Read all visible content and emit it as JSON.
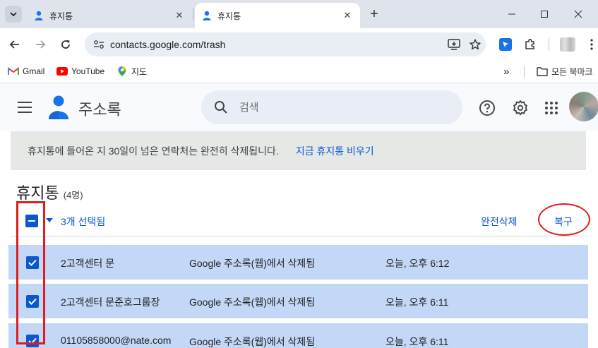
{
  "browser": {
    "tabs": [
      {
        "title": "휴지통",
        "active": false
      },
      {
        "title": "휴지통",
        "active": true
      }
    ],
    "url": "contacts.google.com/trash",
    "bookmarks": [
      {
        "label": "Gmail",
        "icon": "gmail-icon"
      },
      {
        "label": "YouTube",
        "icon": "youtube-icon"
      },
      {
        "label": "지도",
        "icon": "maps-icon"
      }
    ],
    "more_bookmarks_label": "»",
    "bookmarks_folder": "모든 북마크"
  },
  "app": {
    "title": "주소록",
    "search_placeholder": "검색"
  },
  "trash": {
    "notice": "휴지통에 들어온 지 30일이 넘은 연락처는 완전히 삭제됩니다.",
    "empty_now": "지금 휴지통 비우기",
    "heading": "휴지통",
    "count": "(4명)",
    "selected_label": "3개 선택됨",
    "delete_forever": "완전삭제",
    "restore": "복구",
    "rows": [
      {
        "name": "2고객센터 문",
        "source": "Google 주소록(웹)에서 삭제됨",
        "time": "오늘, 오후 6:12",
        "checked": true
      },
      {
        "name": "2고객센터 문준호그룹장",
        "source": "Google 주소록(웹)에서 삭제됨",
        "time": "오늘, 오후 6:11",
        "checked": true
      },
      {
        "name": "01105858000@nate.com",
        "source": "Google 주소록(웹)에서 삭제됨",
        "time": "오늘, 오후 6:11",
        "checked": true
      }
    ]
  },
  "colors": {
    "accent": "#0b57d0",
    "row_selected": "#c3d7f7",
    "annotation": "#e11c1c"
  }
}
